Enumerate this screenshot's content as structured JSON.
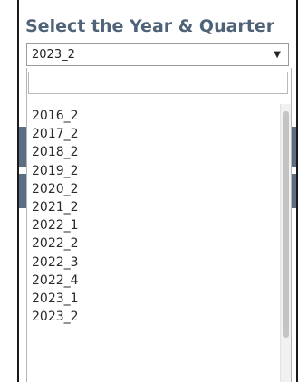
{
  "filter": {
    "title": "Select the Year & Quarter",
    "selected_value": "2023_2",
    "dropdown_icon": "chevron-down-icon",
    "search_placeholder": "",
    "options": [
      "2016_2",
      "2017_2",
      "2018_2",
      "2019_2",
      "2020_2",
      "2021_2",
      "2022_1",
      "2022_2",
      "2022_3",
      "2022_4",
      "2023_1",
      "2023_2"
    ]
  },
  "colors": {
    "title_text": "#4f6378",
    "background_panel": "#5b6e82",
    "frame": "#1a1a1a",
    "border": "#9a9a9a"
  }
}
